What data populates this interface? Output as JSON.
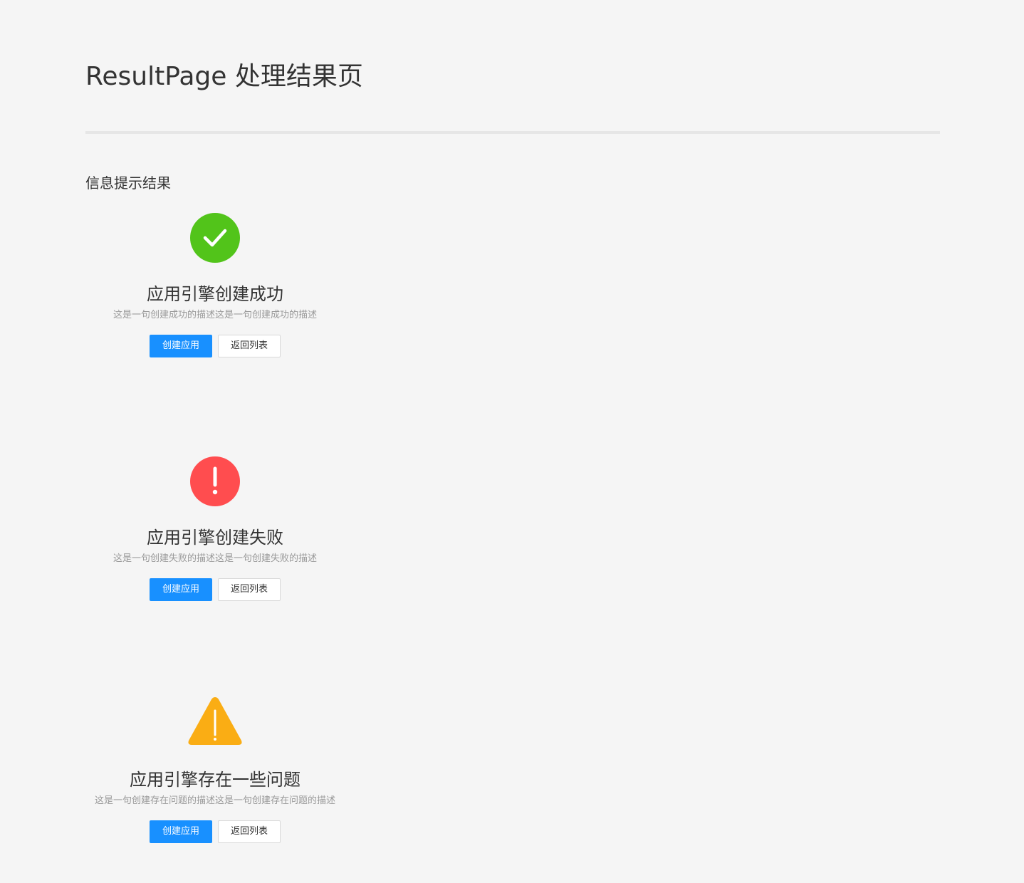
{
  "page": {
    "title": "ResultPage 处理结果页",
    "section_title": "信息提示结果"
  },
  "colors": {
    "background": "#f5f5f5",
    "success": "#52c41a",
    "error": "#ff4d4f",
    "warning": "#faad14",
    "primary": "#1890ff"
  },
  "results": [
    {
      "status": "success",
      "icon": "check-circle-icon",
      "title": "应用引擎创建成功",
      "description": "这是一句创建成功的描述这是一句创建成功的描述",
      "primary_label": "创建应用",
      "secondary_label": "返回列表"
    },
    {
      "status": "error",
      "icon": "exclamation-circle-icon",
      "title": "应用引擎创建失败",
      "description": "这是一句创建失败的描述这是一句创建失败的描述",
      "primary_label": "创建应用",
      "secondary_label": "返回列表"
    },
    {
      "status": "warning",
      "icon": "warning-triangle-icon",
      "title": "应用引擎存在一些问题",
      "description": "这是一句创建存在问题的描述这是一句创建存在问题的描述",
      "primary_label": "创建应用",
      "secondary_label": "返回列表"
    }
  ]
}
